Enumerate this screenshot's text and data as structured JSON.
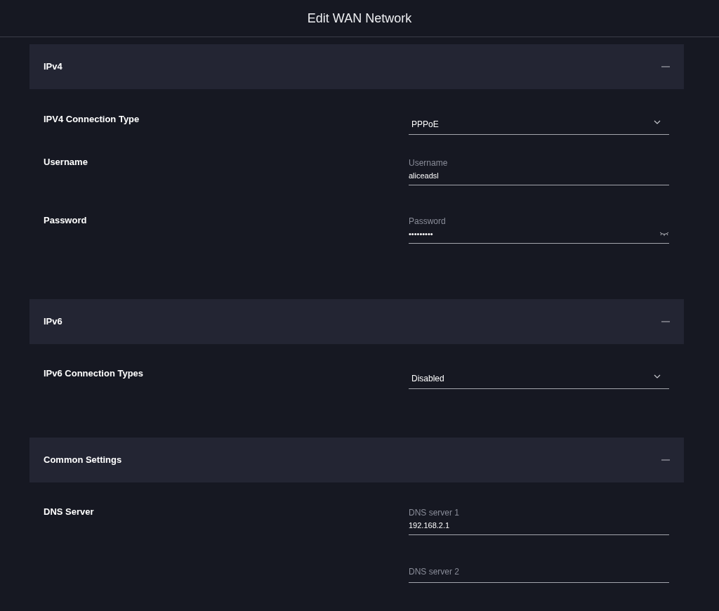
{
  "title": "Edit WAN Network",
  "sections": [
    {
      "title": "IPv4",
      "expanded": true,
      "rows": [
        {
          "label": "IPV4 Connection Type",
          "fields": [
            {
              "kind": "select",
              "value": "PPPoE"
            }
          ]
        },
        {
          "label": "Username",
          "fields": [
            {
              "kind": "text",
              "label": "Username",
              "value": "aliceadsl"
            }
          ]
        },
        {
          "label": "Password",
          "fields": [
            {
              "kind": "password",
              "label": "Password",
              "value": "•••••••••"
            }
          ]
        }
      ]
    },
    {
      "title": "IPv6",
      "expanded": true,
      "rows": [
        {
          "label": "IPv6 Connection Types",
          "fields": [
            {
              "kind": "select",
              "value": "Disabled"
            }
          ]
        }
      ]
    },
    {
      "title": "Common Settings",
      "expanded": true,
      "rows": [
        {
          "label": "DNS Server",
          "fields": [
            {
              "kind": "text",
              "label": "DNS server 1",
              "value": "192.168.2.1"
            },
            {
              "kind": "empty",
              "placeholder": "DNS server 2"
            }
          ]
        }
      ]
    }
  ]
}
